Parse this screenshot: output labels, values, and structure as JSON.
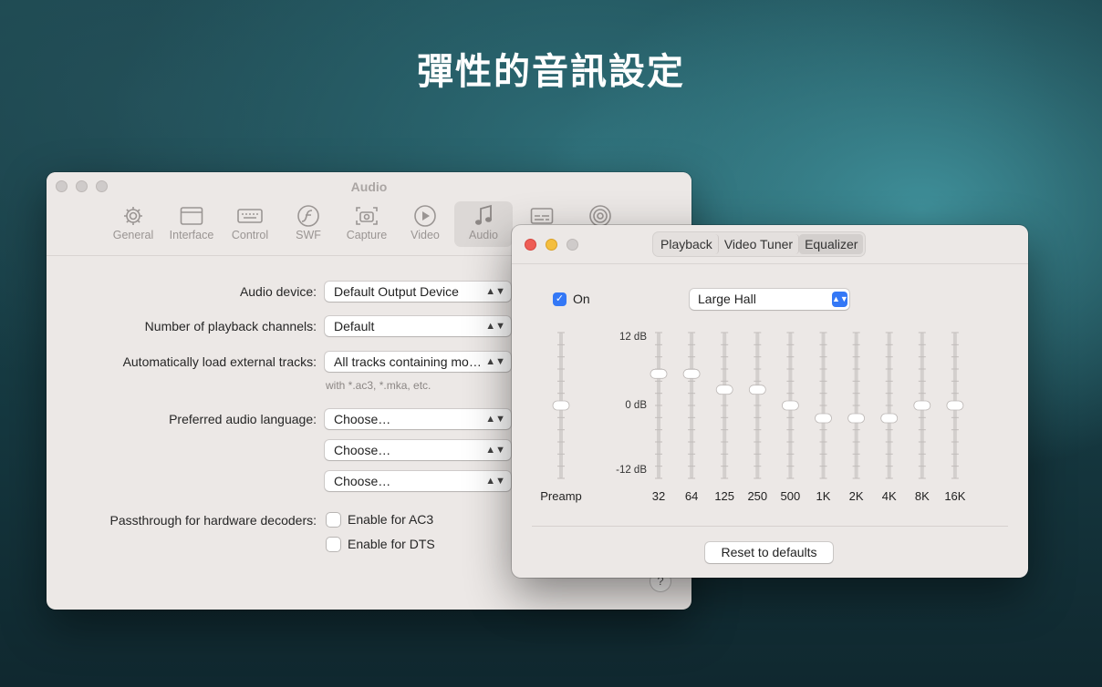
{
  "headline": "彈性的音訊設定",
  "prefs": {
    "title": "Audio",
    "toolbar": [
      {
        "label": "General",
        "icon": "gear-icon"
      },
      {
        "label": "Interface",
        "icon": "window-icon"
      },
      {
        "label": "Control",
        "icon": "keyboard-icon"
      },
      {
        "label": "SWF",
        "icon": "flash-icon"
      },
      {
        "label": "Capture",
        "icon": "camera-icon"
      },
      {
        "label": "Video",
        "icon": "play-icon"
      },
      {
        "label": "Audio",
        "icon": "music-note-icon",
        "active": true
      },
      {
        "label": "",
        "icon": "subtitles-icon"
      },
      {
        "label": "",
        "icon": "airplay-icon"
      }
    ],
    "audio_device_label": "Audio device:",
    "audio_device_value": "Default Output Device",
    "channels_label": "Number of playback channels:",
    "channels_value": "Default",
    "external_label": "Automatically load external tracks:",
    "external_value": "All tracks containing mo…",
    "external_hint": "with *.ac3, *.mka, etc.",
    "language_label": "Preferred audio language:",
    "language_values": [
      "Choose…",
      "Choose…",
      "Choose…"
    ],
    "passthrough_label": "Passthrough for hardware decoders:",
    "ac3_label": "Enable for AC3",
    "dts_label": "Enable for DTS",
    "help": "?"
  },
  "eq": {
    "tabs": [
      "Playback",
      "Video Tuner",
      "Equalizer"
    ],
    "active_tab": "Equalizer",
    "on_label": "On",
    "on_checked": true,
    "preset": "Large Hall",
    "db_top": "12 dB",
    "db_mid": "0 dB",
    "db_bottom": "-12 dB",
    "preamp_label": "Preamp",
    "preamp_db": 0,
    "bands": [
      {
        "label": "32",
        "db": 5.2
      },
      {
        "label": "64",
        "db": 5.2
      },
      {
        "label": "125",
        "db": 2.6
      },
      {
        "label": "250",
        "db": 2.6
      },
      {
        "label": "500",
        "db": 0
      },
      {
        "label": "1K",
        "db": -2.1
      },
      {
        "label": "2K",
        "db": -2.1
      },
      {
        "label": "4K",
        "db": -2.1
      },
      {
        "label": "8K",
        "db": 0
      },
      {
        "label": "16K",
        "db": 0
      }
    ],
    "reset_label": "Reset to defaults"
  }
}
